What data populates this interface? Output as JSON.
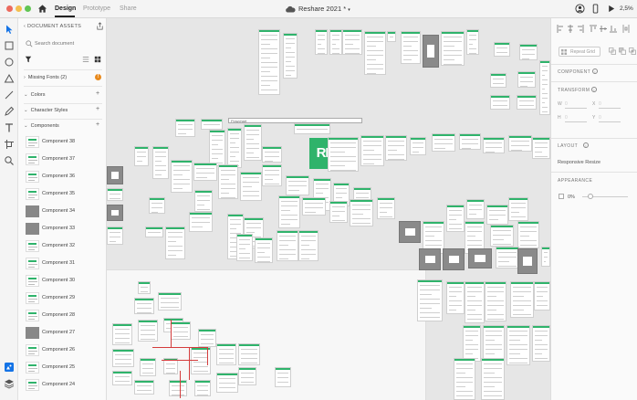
{
  "titlebar": {
    "tabs": [
      {
        "label": "Design",
        "active": true
      },
      {
        "label": "Prototype",
        "active": false
      },
      {
        "label": "Share",
        "active": false
      }
    ],
    "document_title": "Reshare 2021 *",
    "zoom": "2,5%"
  },
  "toolbar": {
    "tools": [
      "select-icon",
      "rectangle-icon",
      "ellipse-icon",
      "triangle-icon",
      "line-icon",
      "pen-icon",
      "text-icon",
      "artboard-icon",
      "zoom-icon"
    ],
    "bottom_tools": [
      "assets-icon",
      "layers-icon"
    ]
  },
  "assets": {
    "header": "DOCUMENT ASSETS",
    "search_placeholder": "Search document",
    "sections": {
      "missing_fonts": "Missing Fonts",
      "missing_fonts_count": "(2)",
      "colors": "Colors",
      "character_styles": "Character Styles",
      "components": "Components"
    },
    "components": [
      {
        "label": "Component 38",
        "dark": false
      },
      {
        "label": "Component 37",
        "dark": false
      },
      {
        "label": "Component 36",
        "dark": false
      },
      {
        "label": "Component 35",
        "dark": false
      },
      {
        "label": "Component 34",
        "dark": true
      },
      {
        "label": "Component 33",
        "dark": true
      },
      {
        "label": "Component 32",
        "dark": false
      },
      {
        "label": "Component 31",
        "dark": false
      },
      {
        "label": "Component 30",
        "dark": false
      },
      {
        "label": "Component 29",
        "dark": false
      },
      {
        "label": "Component 28",
        "dark": false
      },
      {
        "label": "Component 27",
        "dark": true
      },
      {
        "label": "Component 26",
        "dark": false
      },
      {
        "label": "Component 25",
        "dark": false
      },
      {
        "label": "Component 24",
        "dark": false
      }
    ]
  },
  "canvas": {
    "logo_text": "RE",
    "frame_label": "Flowchart"
  },
  "inspector": {
    "repeat_grid": "Repeat Grid",
    "component_heading": "COMPONENT",
    "transform_heading": "TRANSFORM",
    "w_label": "W",
    "h_label": "H",
    "x_label": "X",
    "y_label": "Y",
    "w_value": "0",
    "h_value": "0",
    "x_value": "0",
    "y_value": "0",
    "layout_heading": "LAYOUT",
    "responsive_resize": "Responsive Resize",
    "appearance_heading": "APPEARANCE",
    "opacity": "0%"
  },
  "colors": {
    "accent": "#2fb36b",
    "canvas": "#e6e6e6",
    "warning": "#e8891c"
  }
}
